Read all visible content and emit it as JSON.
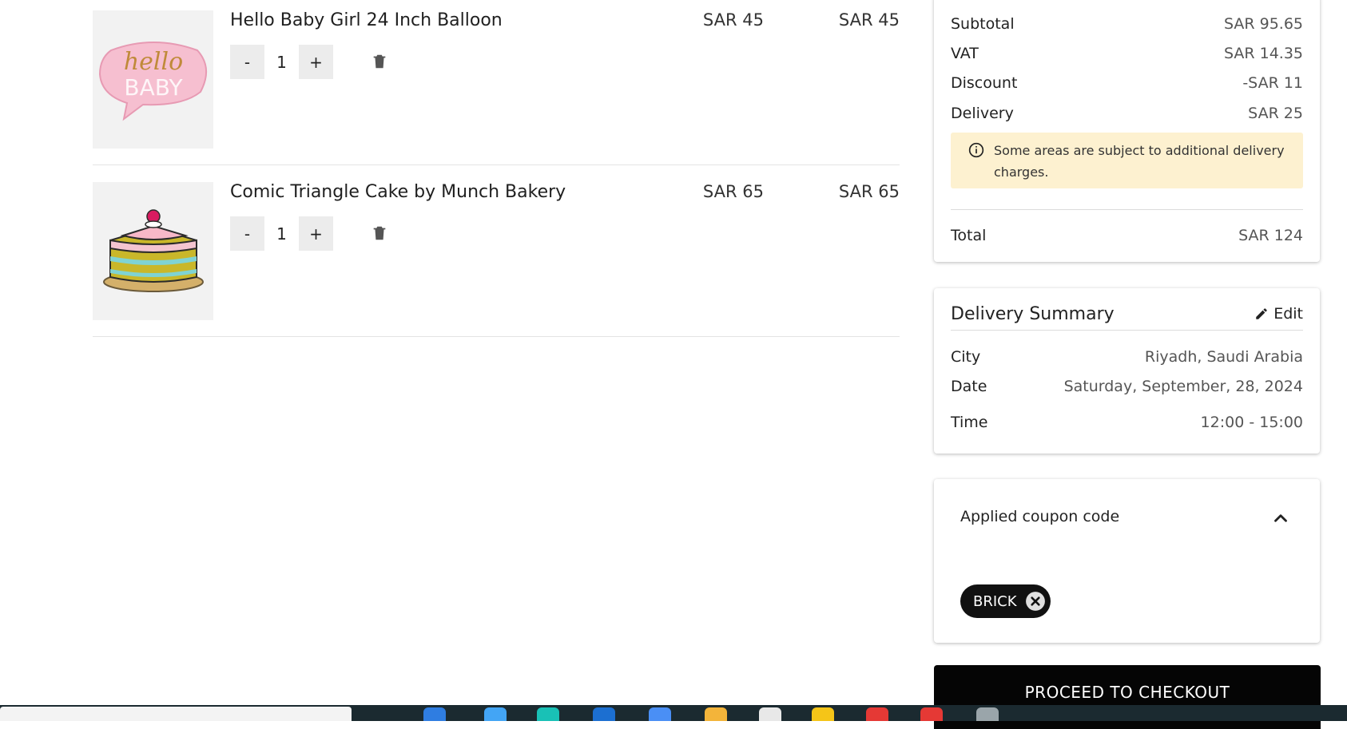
{
  "cart": {
    "items": [
      {
        "name": "Hello Baby Girl 24 Inch Balloon",
        "unit_price": "SAR 45",
        "total": "SAR 45",
        "qty": "1",
        "minus": "-",
        "plus": "+"
      },
      {
        "name": "Comic Triangle Cake by Munch Bakery",
        "unit_price": "SAR 65",
        "total": "SAR 65",
        "qty": "1",
        "minus": "-",
        "plus": "+"
      }
    ]
  },
  "order_summary": {
    "subtotal_label": "Subtotal",
    "subtotal": "SAR 95.65",
    "vat_label": "VAT",
    "vat": "SAR 14.35",
    "discount_label": "Discount",
    "discount": "-SAR 11",
    "delivery_label": "Delivery",
    "delivery": "SAR 25",
    "notice": "Some areas are subject to additional delivery charges.",
    "total_label": "Total",
    "total": "SAR 124"
  },
  "delivery_summary": {
    "title": "Delivery Summary",
    "edit_label": "Edit",
    "city_label": "City",
    "city": "Riyadh, Saudi Arabia",
    "date_label": "Date",
    "date": "Saturday, September, 28, 2024",
    "time_label": "Time",
    "time": "12:00 - 15:00"
  },
  "coupon": {
    "title": "Applied coupon code",
    "code": "BRICK"
  },
  "checkout_label": "PROCEED TO CHECKOUT",
  "colors": {
    "notice_bg": "#fdf1d0",
    "checkout_bg": "#050505",
    "chip_bg": "#111111"
  }
}
